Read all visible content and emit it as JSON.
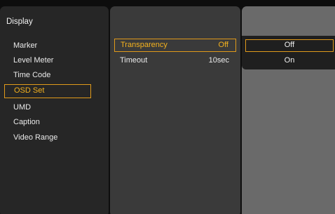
{
  "left_menu": {
    "title": "Display",
    "items": [
      {
        "label": "Marker"
      },
      {
        "label": "Level Meter"
      },
      {
        "label": "Time Code"
      },
      {
        "label": "OSD Set"
      },
      {
        "label": "UMD"
      },
      {
        "label": "Caption"
      },
      {
        "label": "Video Range"
      }
    ],
    "selected_index": 3
  },
  "settings": {
    "rows": [
      {
        "label": "Transparency",
        "value": "Off"
      },
      {
        "label": "Timeout",
        "value": "10sec"
      }
    ],
    "selected_index": 0
  },
  "options": {
    "items": [
      {
        "label": "Off"
      },
      {
        "label": "On"
      }
    ],
    "selected_index": 0
  },
  "colors": {
    "accent": "#e09a1a",
    "selected_text": "#f5b21e"
  }
}
